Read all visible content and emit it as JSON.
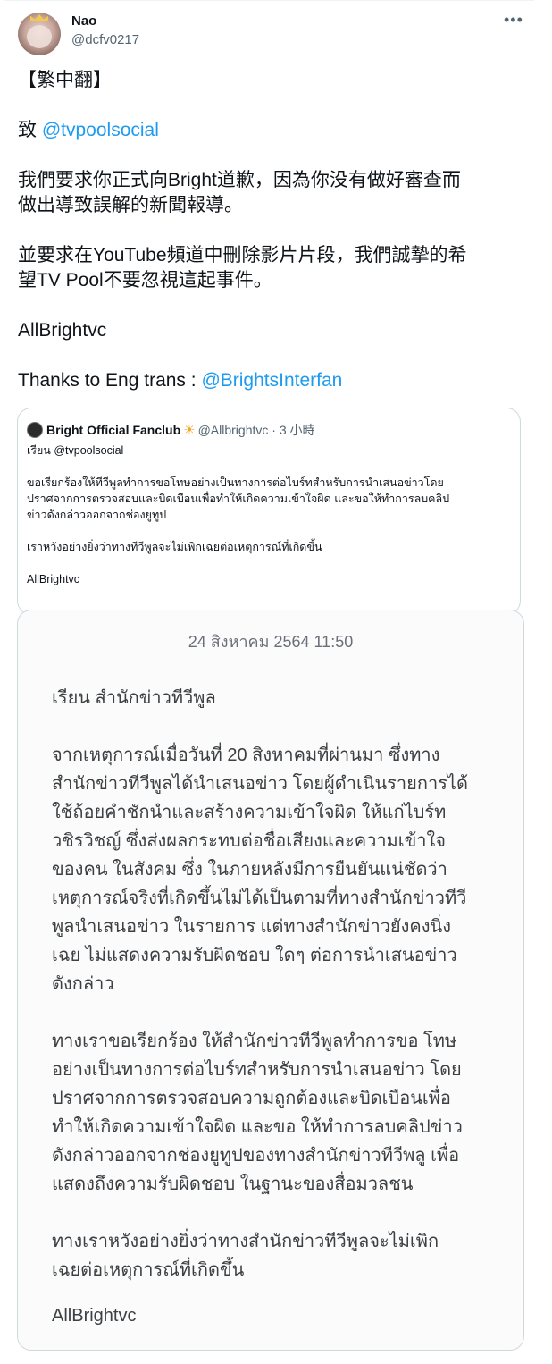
{
  "user": {
    "display_name": "Nao",
    "handle": "@dcfv0217"
  },
  "tweet": {
    "line1": "【繁中翻】",
    "to_prefix": "致 ",
    "to_mention": "@tvpoolsocial",
    "para1_l1": "我們要求你正式向Bright道歉，因為你没有做好審查而",
    "para1_l2": "做出導致誤解的新聞報導。",
    "para2_l1": "並要求在YouTube頻道中刪除影片片段，我們誠摯的希",
    "para2_l2": "望TV Pool不要忽視這起事件。",
    "sign": "AllBrightvc",
    "thanks_prefix": "Thanks to Eng trans : ",
    "thanks_mention": "@BrightsInterfan"
  },
  "quote": {
    "name": "Bright Official Fanclub",
    "emoji": "☀",
    "handle": "@Allbrightvc",
    "time": "· 3 小時",
    "line1": "เรียน @tvpoolsocial",
    "line2": "ขอเรียกร้องให้ทีวีพูลทำการขอโทษอย่างเป็นทางการต่อไบร์ทสำหรับการนำเสนอข่าวโดย",
    "line3": "ปราศจากการตรวจสอบและบิดเบือนเพื่อทำให้เกิดความเข้าใจผิด และขอให้ทำการลบคลิป",
    "line4": "ข่าวดังกล่าวออกจากช่องยูทูป",
    "line5": "เราหวังอย่างยิ่งว่าทางทีวีพูลจะไม่เพิกเฉยต่อเหตุการณ์ที่เกิดขึ้น",
    "line6": "AllBrightvc"
  },
  "image": {
    "date": "24 สิงหาคม 2564 11:50",
    "salutation": "เรียน สำนักข่าวทีวีพูล",
    "p1": [
      "จากเหตุการณ์เมื่อวันที่ 20 สิงหาคมที่ผ่านมา ซึ่งทาง",
      "สำนักข่าวทีวีพูลได้นำเสนอข่าว โดยผู้ดำเนินรายการได้",
      "ใช้ถ้อยคำชักนำและสร้างความเข้าใจผิด ให้แก่ไบร์ท",
      "วชิรวิชญ์ ซึ่งส่งผลกระทบต่อชื่อเสียงและความเข้าใจ",
      "ของคน ในสังคม ซึ่ง ในภายหลังมีการยืนยันแน่ชัดว่า",
      "เหตุการณ์จริงที่เกิดขึ้นไม่ได้เป็นตามที่ทางสำนักข่าวทีวี",
      "พูลนำเสนอข่าว ในรายการ แต่ทางสำนักข่าวยังคงนิ่ง",
      "เฉย ไม่แสดงความรับผิดชอบ ใดๆ ต่อการนำเสนอข่าว",
      "ดังกล่าว"
    ],
    "p2": [
      "ทางเราขอเรียกร้อง ให้สำนักข่าวทีวีพูลทำการขอ โทษ",
      "อย่างเป็นทางการต่อไบร์ทสำหรับการนำเสนอข่าว โดย",
      "ปราศจากการตรวจสอบความถูกต้องและบิดเบือนเพื่อ",
      "ทำให้เกิดความเข้าใจผิด และขอ ให้ทำการลบคลิปข่าว",
      "ดังกล่าวออกจากช่องยูทูปของทางสำนักข่าวทีวีพลู เพื่อ",
      "แสดงถึงความรับผิดชอบ ในฐานะของสื่อมวลชน"
    ],
    "p3": [
      "ทางเราหวังอย่างยิ่งว่าทางสำนักข่าวทีวีพูลจะไม่เพิก",
      "เฉยต่อเหตุการณ์ที่เกิดขึ้น"
    ],
    "sign": "AllBrightvc"
  }
}
